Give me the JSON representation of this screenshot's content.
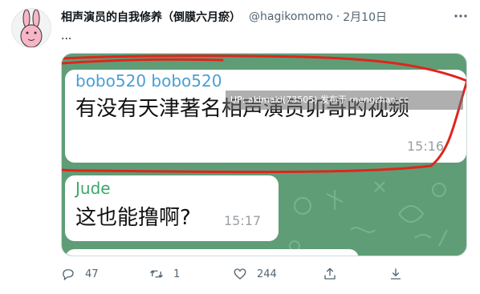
{
  "tweet": {
    "display_name": "相声演员的自我修养（倒膜六月瘀）",
    "handle": "@hagikomomo",
    "separator": "·",
    "date": "2月10日",
    "text": "..."
  },
  "media": {
    "message1": {
      "sender": "bobo520 bobo520",
      "text": "有没有天津著名相声演员卯哥的视频",
      "time": "15:16"
    },
    "message2": {
      "sender": "Jude",
      "text": "这也能撸啊?",
      "time": "15:17"
    },
    "watermark": "UP: akimaki(73505) 发布于 mengzhan.cc",
    "sender_color_1": "#4a9fd4",
    "sender_color_2": "#3aa86a",
    "annotation_color": "#e0251b",
    "background_color": "#5f9d77"
  },
  "actions": {
    "reply_count": "47",
    "retweet_count": "1",
    "like_count": "244"
  },
  "icons": {
    "more": "more-icon",
    "reply": "reply-icon",
    "retweet": "retweet-icon",
    "like": "heart-icon",
    "share": "share-icon",
    "download": "download-icon"
  }
}
